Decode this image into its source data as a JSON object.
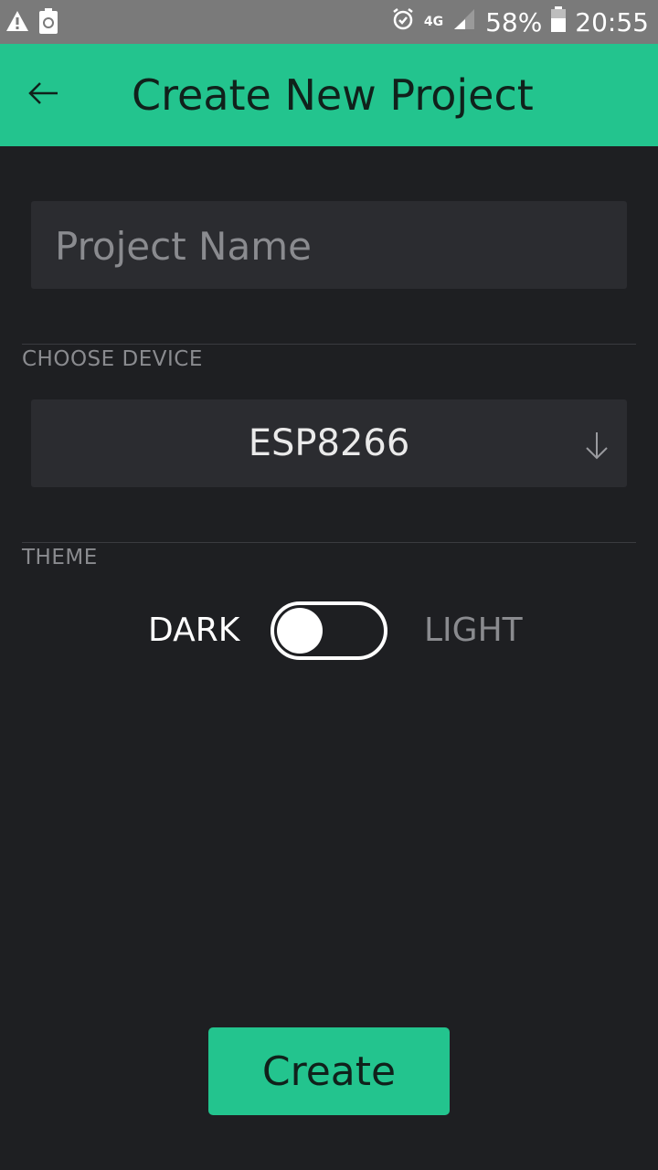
{
  "status_bar": {
    "battery": "58%",
    "time": "20:55",
    "network": "4G",
    "icons": [
      "warning-icon",
      "recycle-icon",
      "alarm-icon",
      "signal-icon",
      "battery-icon"
    ]
  },
  "app_bar": {
    "title": "Create New Project",
    "background_color": "#23c48e",
    "back_icon": "arrow-left-icon"
  },
  "form": {
    "project_name": {
      "placeholder": "Project Name",
      "value": ""
    },
    "device": {
      "section_label": "CHOOSE DEVICE",
      "selected": "ESP8266",
      "icon": "arrow-down-icon"
    },
    "theme": {
      "section_label": "THEME",
      "dark_label": "DARK",
      "light_label": "LIGHT",
      "selected": "DARK"
    }
  },
  "actions": {
    "create_label": "Create",
    "accent_color": "#23c48e"
  }
}
